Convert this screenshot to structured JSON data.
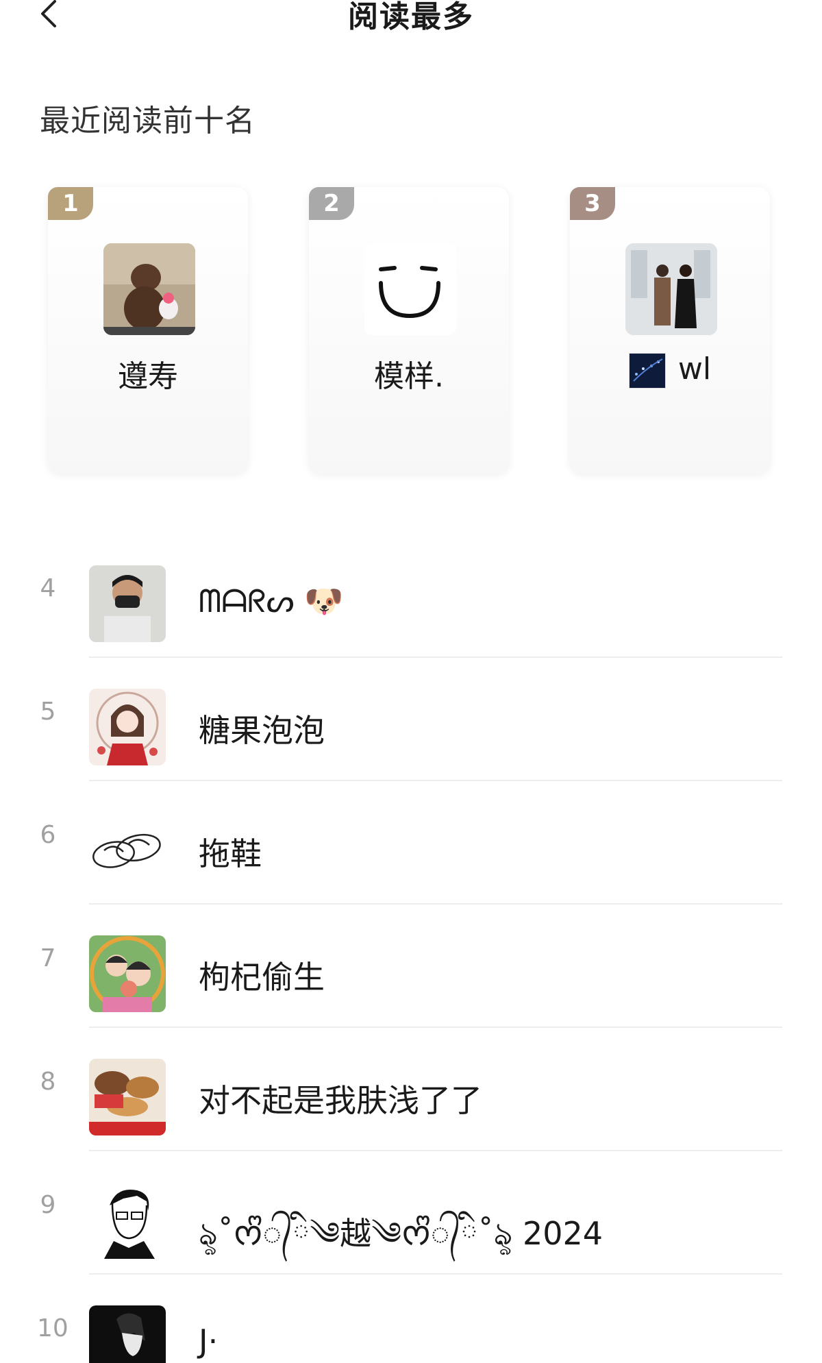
{
  "header": {
    "title": "阅读最多",
    "back_icon": "chevron-left-icon"
  },
  "section": {
    "title": "最近阅读前十名"
  },
  "top3": [
    {
      "rank": "1",
      "name": "遵寿",
      "badge_color": "#b8a27c"
    },
    {
      "rank": "2",
      "name": "模样.",
      "badge_color": "#a9a9a9"
    },
    {
      "rank": "3",
      "name": "wl",
      "badge_color": "#a68e84"
    }
  ],
  "list": [
    {
      "rank": "4",
      "name": "ᗰᗩᖇᔕ 🐶"
    },
    {
      "rank": "5",
      "name": "糖果泡泡"
    },
    {
      "rank": "6",
      "name": "拖鞋"
    },
    {
      "rank": "7",
      "name": "枸杞偷生"
    },
    {
      "rank": "8",
      "name": "对不起是我肤浅了了"
    },
    {
      "rank": "9",
      "name": "ৡ˚ᰔᩚ᭄ི༄越༄ᰔᩚ᭄ི˚ৡ 2024"
    },
    {
      "rank": "10",
      "name": "J·"
    }
  ]
}
